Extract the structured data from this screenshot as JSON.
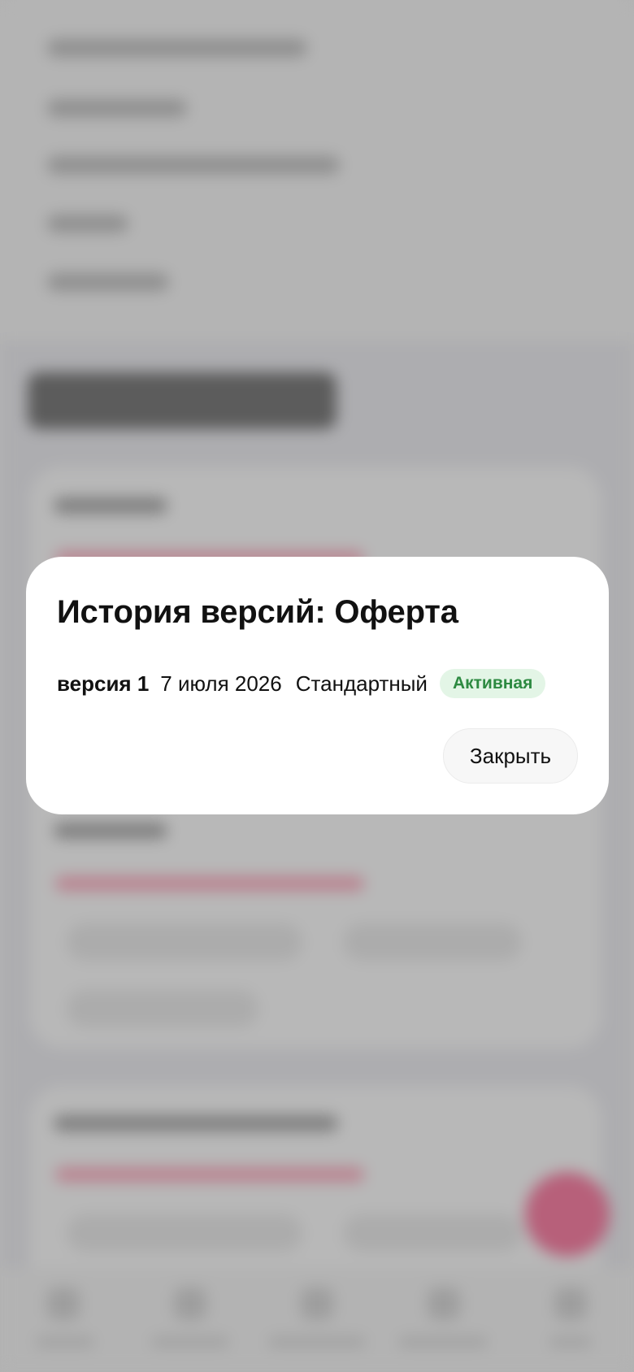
{
  "modal": {
    "title": "История версий: Оферта",
    "versions": [
      {
        "label": "версия 1",
        "date": "7 июля 2026",
        "type": "Стандартный",
        "status": "Активная"
      }
    ],
    "close_label": "Закрыть"
  },
  "colors": {
    "status_active_bg": "#e3f5e6",
    "status_active_text": "#2d8a41",
    "accent_pink": "#b7607a"
  },
  "icons": {
    "fab": "fab-button-icon"
  }
}
